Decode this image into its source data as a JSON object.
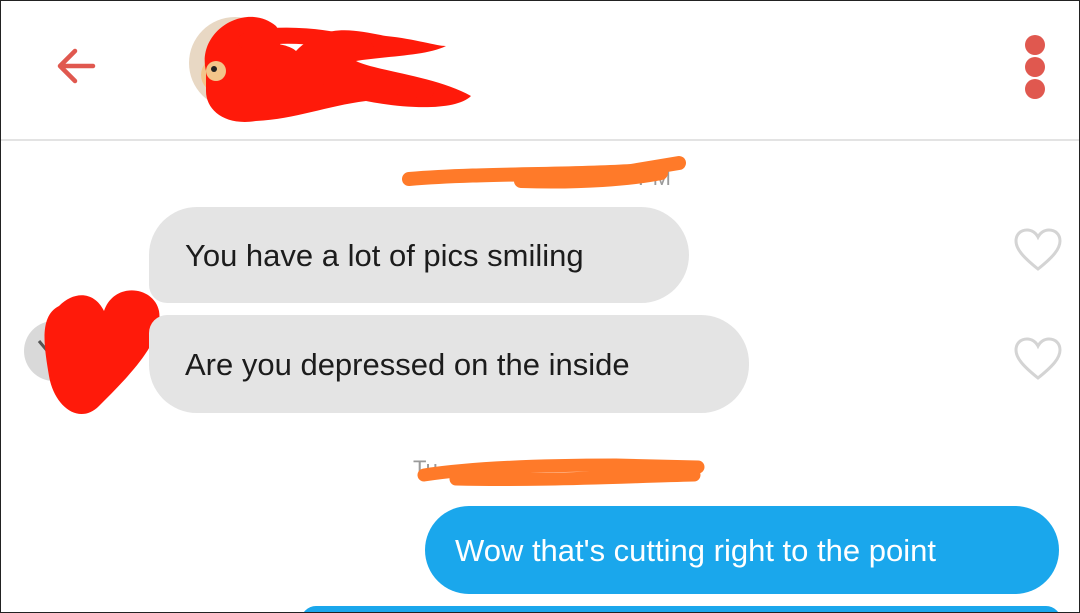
{
  "header": {
    "back_icon": "arrow-left-icon",
    "menu_icon": "more-vertical-icon",
    "accent_color": "#e0584f"
  },
  "conversation": {
    "timestamp_1": "PM",
    "timestamp_2": "Tu",
    "received": [
      {
        "text": "You have a lot of pics smiling",
        "like_icon": "heart-outline-icon"
      },
      {
        "text": "Are you depressed on the inside",
        "like_icon": "heart-outline-icon"
      }
    ],
    "sent": [
      {
        "text": "Wow that's cutting right to the point"
      }
    ],
    "colors": {
      "received_bubble": "#e4e4e4",
      "sent_bubble": "#1aa7ec",
      "redaction_red": "#ff1a0a",
      "redaction_orange": "#ff7a29"
    }
  }
}
